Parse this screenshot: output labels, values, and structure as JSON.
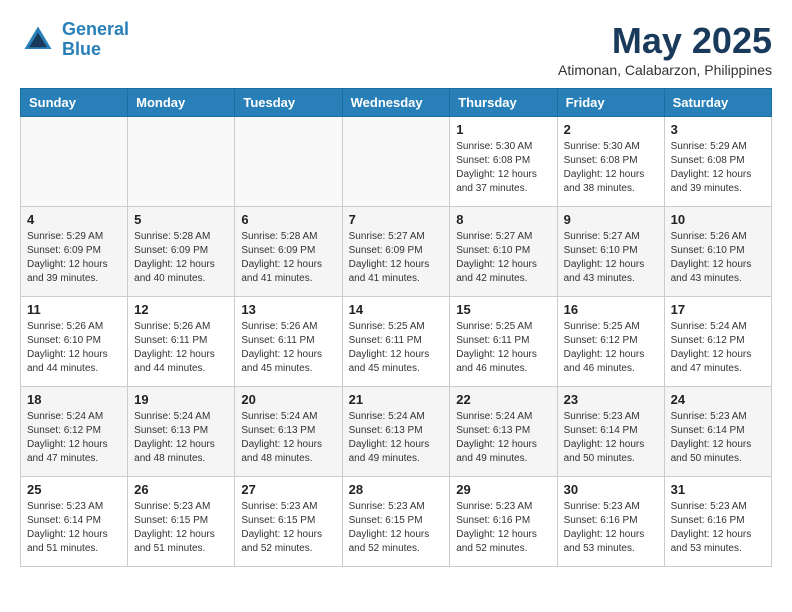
{
  "header": {
    "logo_line1": "General",
    "logo_line2": "Blue",
    "month_title": "May 2025",
    "location": "Atimonan, Calabarzon, Philippines"
  },
  "weekdays": [
    "Sunday",
    "Monday",
    "Tuesday",
    "Wednesday",
    "Thursday",
    "Friday",
    "Saturday"
  ],
  "weeks": [
    [
      {
        "day": "",
        "info": ""
      },
      {
        "day": "",
        "info": ""
      },
      {
        "day": "",
        "info": ""
      },
      {
        "day": "",
        "info": ""
      },
      {
        "day": "1",
        "info": "Sunrise: 5:30 AM\nSunset: 6:08 PM\nDaylight: 12 hours\nand 37 minutes."
      },
      {
        "day": "2",
        "info": "Sunrise: 5:30 AM\nSunset: 6:08 PM\nDaylight: 12 hours\nand 38 minutes."
      },
      {
        "day": "3",
        "info": "Sunrise: 5:29 AM\nSunset: 6:08 PM\nDaylight: 12 hours\nand 39 minutes."
      }
    ],
    [
      {
        "day": "4",
        "info": "Sunrise: 5:29 AM\nSunset: 6:09 PM\nDaylight: 12 hours\nand 39 minutes."
      },
      {
        "day": "5",
        "info": "Sunrise: 5:28 AM\nSunset: 6:09 PM\nDaylight: 12 hours\nand 40 minutes."
      },
      {
        "day": "6",
        "info": "Sunrise: 5:28 AM\nSunset: 6:09 PM\nDaylight: 12 hours\nand 41 minutes."
      },
      {
        "day": "7",
        "info": "Sunrise: 5:27 AM\nSunset: 6:09 PM\nDaylight: 12 hours\nand 41 minutes."
      },
      {
        "day": "8",
        "info": "Sunrise: 5:27 AM\nSunset: 6:10 PM\nDaylight: 12 hours\nand 42 minutes."
      },
      {
        "day": "9",
        "info": "Sunrise: 5:27 AM\nSunset: 6:10 PM\nDaylight: 12 hours\nand 43 minutes."
      },
      {
        "day": "10",
        "info": "Sunrise: 5:26 AM\nSunset: 6:10 PM\nDaylight: 12 hours\nand 43 minutes."
      }
    ],
    [
      {
        "day": "11",
        "info": "Sunrise: 5:26 AM\nSunset: 6:10 PM\nDaylight: 12 hours\nand 44 minutes."
      },
      {
        "day": "12",
        "info": "Sunrise: 5:26 AM\nSunset: 6:11 PM\nDaylight: 12 hours\nand 44 minutes."
      },
      {
        "day": "13",
        "info": "Sunrise: 5:26 AM\nSunset: 6:11 PM\nDaylight: 12 hours\nand 45 minutes."
      },
      {
        "day": "14",
        "info": "Sunrise: 5:25 AM\nSunset: 6:11 PM\nDaylight: 12 hours\nand 45 minutes."
      },
      {
        "day": "15",
        "info": "Sunrise: 5:25 AM\nSunset: 6:11 PM\nDaylight: 12 hours\nand 46 minutes."
      },
      {
        "day": "16",
        "info": "Sunrise: 5:25 AM\nSunset: 6:12 PM\nDaylight: 12 hours\nand 46 minutes."
      },
      {
        "day": "17",
        "info": "Sunrise: 5:24 AM\nSunset: 6:12 PM\nDaylight: 12 hours\nand 47 minutes."
      }
    ],
    [
      {
        "day": "18",
        "info": "Sunrise: 5:24 AM\nSunset: 6:12 PM\nDaylight: 12 hours\nand 47 minutes."
      },
      {
        "day": "19",
        "info": "Sunrise: 5:24 AM\nSunset: 6:13 PM\nDaylight: 12 hours\nand 48 minutes."
      },
      {
        "day": "20",
        "info": "Sunrise: 5:24 AM\nSunset: 6:13 PM\nDaylight: 12 hours\nand 48 minutes."
      },
      {
        "day": "21",
        "info": "Sunrise: 5:24 AM\nSunset: 6:13 PM\nDaylight: 12 hours\nand 49 minutes."
      },
      {
        "day": "22",
        "info": "Sunrise: 5:24 AM\nSunset: 6:13 PM\nDaylight: 12 hours\nand 49 minutes."
      },
      {
        "day": "23",
        "info": "Sunrise: 5:23 AM\nSunset: 6:14 PM\nDaylight: 12 hours\nand 50 minutes."
      },
      {
        "day": "24",
        "info": "Sunrise: 5:23 AM\nSunset: 6:14 PM\nDaylight: 12 hours\nand 50 minutes."
      }
    ],
    [
      {
        "day": "25",
        "info": "Sunrise: 5:23 AM\nSunset: 6:14 PM\nDaylight: 12 hours\nand 51 minutes."
      },
      {
        "day": "26",
        "info": "Sunrise: 5:23 AM\nSunset: 6:15 PM\nDaylight: 12 hours\nand 51 minutes."
      },
      {
        "day": "27",
        "info": "Sunrise: 5:23 AM\nSunset: 6:15 PM\nDaylight: 12 hours\nand 52 minutes."
      },
      {
        "day": "28",
        "info": "Sunrise: 5:23 AM\nSunset: 6:15 PM\nDaylight: 12 hours\nand 52 minutes."
      },
      {
        "day": "29",
        "info": "Sunrise: 5:23 AM\nSunset: 6:16 PM\nDaylight: 12 hours\nand 52 minutes."
      },
      {
        "day": "30",
        "info": "Sunrise: 5:23 AM\nSunset: 6:16 PM\nDaylight: 12 hours\nand 53 minutes."
      },
      {
        "day": "31",
        "info": "Sunrise: 5:23 AM\nSunset: 6:16 PM\nDaylight: 12 hours\nand 53 minutes."
      }
    ]
  ]
}
